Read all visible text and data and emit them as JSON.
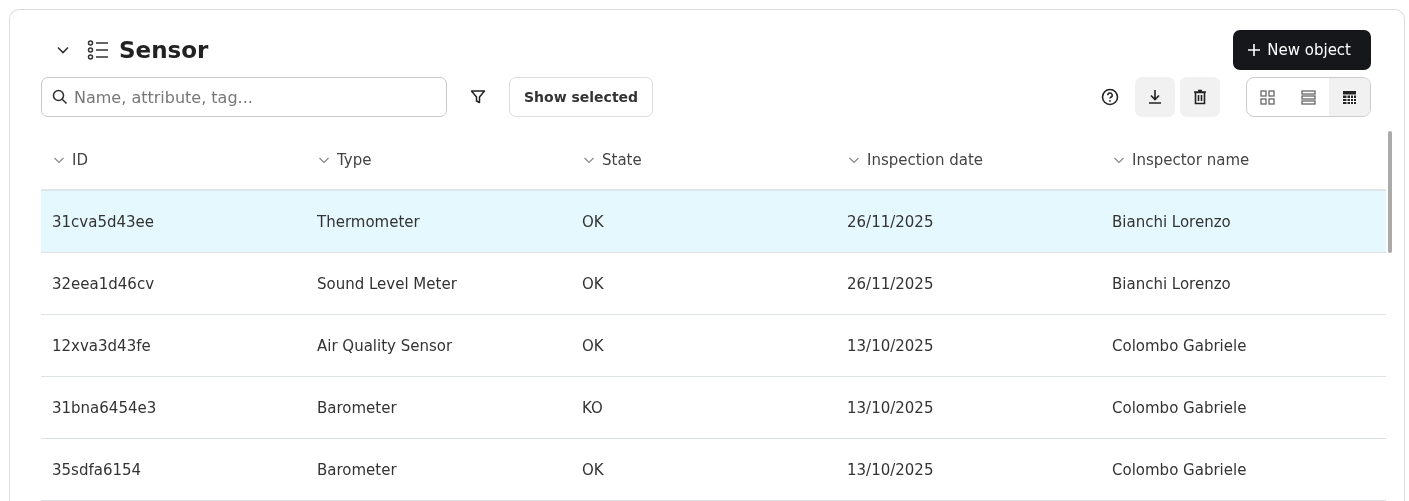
{
  "panel": {
    "title": "Sensor",
    "expanded": true,
    "new_button": "New object"
  },
  "toolbar": {
    "search": {
      "placeholder": "Name, attribute, tag..."
    },
    "show_selected": "Show selected",
    "views": [
      {
        "kind": "grid",
        "selected": false
      },
      {
        "kind": "list",
        "selected": false
      },
      {
        "kind": "table",
        "selected": true
      }
    ]
  },
  "table": {
    "columns": [
      "ID",
      "Type",
      "State",
      "Inspection date",
      "Inspector name"
    ],
    "rows": [
      {
        "cells": [
          "31cva5d43ee",
          "Thermometer",
          "OK",
          "26/11/2025",
          "Bianchi Lorenzo"
        ],
        "selected": true
      },
      {
        "cells": [
          "32eea1d46cv",
          "Sound Level Meter",
          "OK",
          "26/11/2025",
          "Bianchi Lorenzo"
        ],
        "selected": false
      },
      {
        "cells": [
          "12xva3d43fe",
          "Air Quality Sensor",
          "OK",
          "13/10/2025",
          "Colombo Gabriele"
        ],
        "selected": false
      },
      {
        "cells": [
          "31bna6454e3",
          "Barometer",
          "KO",
          "13/10/2025",
          "Colombo Gabriele"
        ],
        "selected": false
      },
      {
        "cells": [
          "35sdfa6154",
          "Barometer",
          "OK",
          "13/10/2025",
          "Colombo Gabriele"
        ],
        "selected": false
      }
    ]
  }
}
